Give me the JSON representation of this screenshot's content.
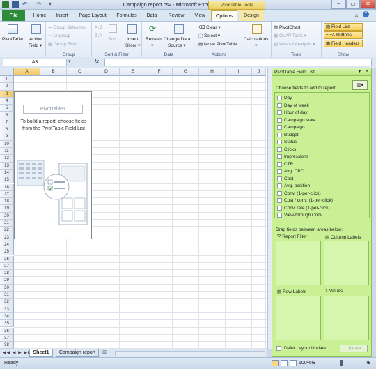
{
  "window": {
    "title": "Campaign report.csv - Microsoft Excel",
    "context_tab": "PivotTable Tools"
  },
  "tabs": [
    "File",
    "Home",
    "Insert",
    "Page Layout",
    "Formulas",
    "Data",
    "Review",
    "View",
    "Options",
    "Design"
  ],
  "active_tab": "Options",
  "ribbon": {
    "pivottable": {
      "label": "PivotTable",
      "group": ""
    },
    "active_field": {
      "line1": "Active",
      "line2": "Field ▾"
    },
    "group_selection": "Group Selection",
    "ungroup": "Ungroup",
    "group_field": "Group Field",
    "group_label": "Group",
    "sort_az": "A↓Z",
    "sort": "Sort",
    "insert_slicer": {
      "line1": "Insert",
      "line2": "Slicer ▾"
    },
    "sort_filter_label": "Sort & Filter",
    "refresh": {
      "line1": "Refresh",
      "line2": "▾"
    },
    "change_source": {
      "line1": "Change Data",
      "line2": "Source ▾"
    },
    "data_label": "Data",
    "clear": "Clear ▾",
    "select": "Select ▾",
    "move_pivot": "Move PivotTable",
    "actions_label": "Actions",
    "calculations": {
      "line1": "Calculations",
      "line2": "▾"
    },
    "pivotchart": "PivotChart",
    "olap_tools": "OLAP Tools ▾",
    "whatif": "What-If Analysis ▾",
    "tools_label": "Tools",
    "field_list": "Field List",
    "plusminus": "+/- Buttons",
    "field_headers": "Field Headers",
    "show_label": "Show"
  },
  "formula_bar": {
    "name_box": "A3",
    "fx": "fx",
    "value": ""
  },
  "grid": {
    "columns": [
      "A",
      "B",
      "C",
      "D",
      "E",
      "F",
      "G",
      "H",
      "I",
      "J"
    ],
    "rows": [
      "1",
      "2",
      "3",
      "4",
      "5",
      "6",
      "7",
      "8",
      "9",
      "10",
      "11",
      "12",
      "13",
      "14",
      "15",
      "16",
      "17",
      "18",
      "19",
      "20",
      "21",
      "22",
      "23",
      "24",
      "25",
      "26",
      "27",
      "28",
      "29",
      "30",
      "31",
      "32",
      "33",
      "34",
      "35",
      "36",
      "37",
      "38"
    ],
    "pivot_placeholder": {
      "title": "PivotTable1",
      "text": "To build a report, choose fields from the PivotTable Field List"
    }
  },
  "field_list": {
    "title": "PivotTable Field List",
    "choose_label": "Choose fields to add to report:",
    "fields": [
      "Day",
      "Day of week",
      "Hour of day",
      "Campaign state",
      "Campaign",
      "Budget",
      "Status",
      "Clicks",
      "Impressions",
      "CTR",
      "Avg. CPC",
      "Cost",
      "Avg. position",
      "Conv. (1-per-click)",
      "Cost / conv. (1-per-click)",
      "Conv. rate (1-per-click)",
      "View-through Conv."
    ],
    "drag_label": "Drag fields between areas below:",
    "areas": {
      "filter": "Report Filter",
      "columns": "Column Labels",
      "rows": "Row Labels",
      "values": "Values"
    },
    "defer_label": "Defer Layout Update",
    "update_button": "Update"
  },
  "sheets": {
    "tabs": [
      "Sheet1",
      "Campaign report"
    ],
    "active": "Sheet1"
  },
  "status": {
    "ready": "Ready",
    "zoom": "100%"
  }
}
